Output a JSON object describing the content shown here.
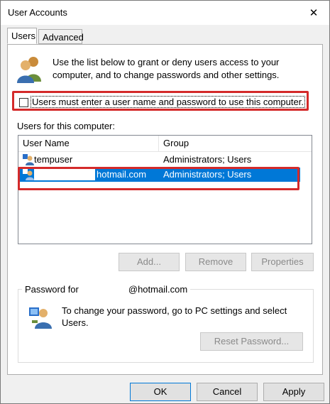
{
  "window": {
    "title": "User Accounts",
    "close_label": "✕"
  },
  "tabs": [
    {
      "label": "Users"
    },
    {
      "label": "Advanced"
    }
  ],
  "intro_text": "Use the list below to grant or deny users access to your computer, and to change passwords and other settings.",
  "must_login_checkbox": {
    "label": "Users must enter a user name and password to use this computer.",
    "checked": false
  },
  "users_section_label": "Users for this computer:",
  "users_table": {
    "columns": [
      "User Name",
      "Group"
    ],
    "rows": [
      {
        "user": "tempuser",
        "group": "Administrators; Users",
        "selected": false
      },
      {
        "user": "hotmail.com",
        "group": "Administrators; Users",
        "selected": true
      }
    ]
  },
  "list_buttons": {
    "add": "Add...",
    "remove": "Remove",
    "properties": "Properties"
  },
  "password_group": {
    "legend_prefix": "Password for",
    "legend_suffix": "@hotmail.com",
    "text": "To change your password, go to PC settings and select Users.",
    "reset_label": "Reset Password..."
  },
  "dialog_buttons": {
    "ok": "OK",
    "cancel": "Cancel",
    "apply": "Apply"
  },
  "colors": {
    "selection": "#0078d7",
    "highlight_outline": "#d42a2a"
  },
  "icons": {
    "users": "users-group-icon",
    "user_row": "user-icon",
    "password": "user-key-icon",
    "close": "close-icon"
  }
}
